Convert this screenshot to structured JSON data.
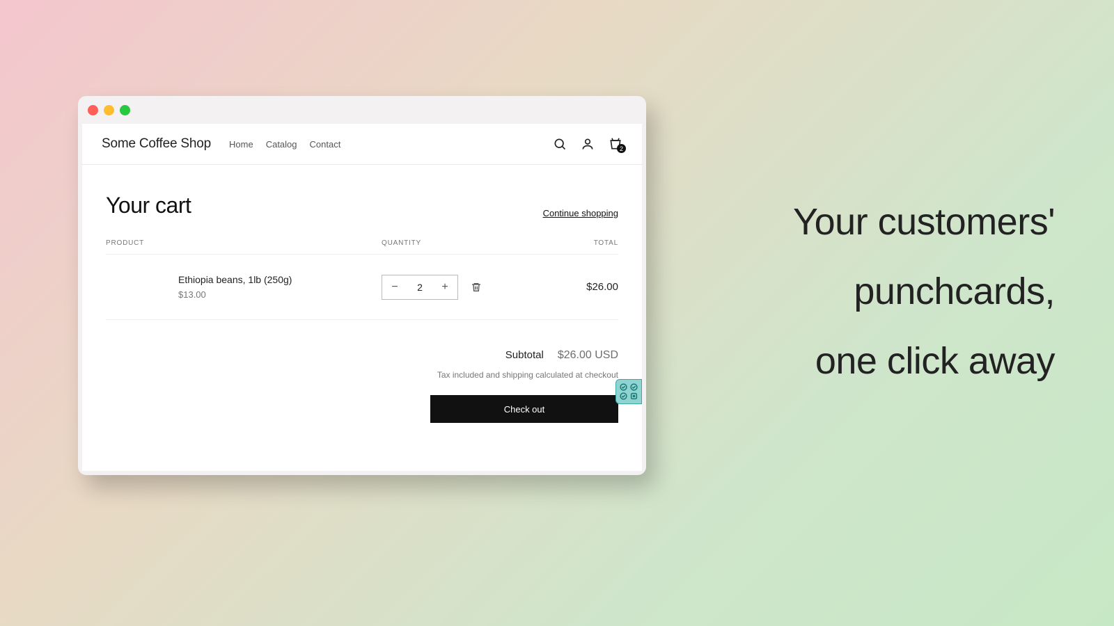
{
  "marketing": {
    "line1": "Your customers'",
    "line2": "punchcards,",
    "line3": "one click away"
  },
  "shop": {
    "brand": "Some Coffee Shop",
    "nav": {
      "home": "Home",
      "catalog": "Catalog",
      "contact": "Contact"
    },
    "cart_badge": "2"
  },
  "cart": {
    "title": "Your cart",
    "continue_label": "Continue shopping",
    "columns": {
      "product": "PRODUCT",
      "quantity": "QUANTITY",
      "total": "TOTAL"
    },
    "item": {
      "name": "Ethiopia beans, 1lb (250g)",
      "unit_price": "$13.00",
      "qty": "2",
      "line_total": "$26.00"
    },
    "subtotal_label": "Subtotal",
    "subtotal_value": "$26.00 USD",
    "tax_note": "Tax included and shipping calculated at checkout",
    "checkout_label": "Check out"
  }
}
